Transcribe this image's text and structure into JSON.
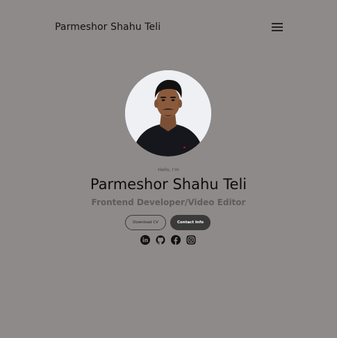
{
  "header": {
    "logo_text": "Parmeshor Shahu Teli",
    "menu_icon": "hamburger-menu-icon"
  },
  "hero": {
    "greeting": "Hello, I'm",
    "name": "Parmeshor Shahu Teli",
    "role": "Frontend Developer/Video Editor",
    "buttons": {
      "download_cv": "Download CV",
      "contact_info": "Contact Info"
    },
    "socials": [
      {
        "icon": "linkedin-icon"
      },
      {
        "icon": "github-icon"
      },
      {
        "icon": "facebook-icon"
      },
      {
        "icon": "instagram-icon"
      }
    ]
  },
  "colors": {
    "background": "#8e8a8a",
    "text_dark": "#0d0d0d",
    "role_text": "#5e5b5b",
    "button_dark": "#3a3a3a"
  }
}
